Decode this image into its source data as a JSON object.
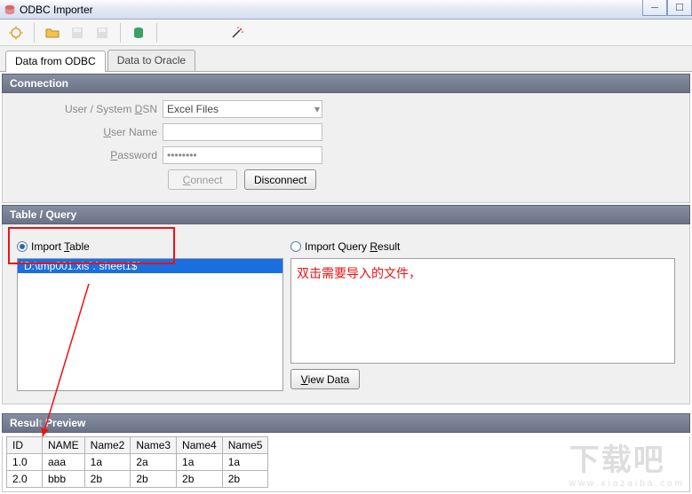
{
  "window": {
    "title": "ODBC Importer"
  },
  "toolbar": {
    "icons": [
      "new",
      "open",
      "save",
      "save-disabled",
      "db",
      "wand"
    ]
  },
  "tabs": {
    "items": [
      {
        "label": "Data from ODBC",
        "active": true
      },
      {
        "label": "Data to Oracle",
        "active": false
      }
    ]
  },
  "connection": {
    "header": "Connection",
    "dsn_label": "User / System DSN",
    "dsn_value": "Excel Files",
    "user_label": "User Name",
    "user_value": "",
    "password_label": "Password",
    "password_value": "********",
    "connect_label": "Connect",
    "disconnect_label": "Disconnect"
  },
  "table_query": {
    "header": "Table / Query",
    "import_table_label": "Import Table",
    "import_query_label": "Import Query Result",
    "selected_file": "`D:\\tmp001.xls`.`sheet1$`",
    "annotation_text": "双击需要导入的文件，",
    "view_data_label": "View Data"
  },
  "result_preview": {
    "header": "Result Preview",
    "columns": [
      "ID",
      "NAME",
      "Name2",
      "Name3",
      "Name4",
      "Name5"
    ],
    "rows": [
      [
        "1.0",
        "aaa",
        "1a",
        "2a",
        "1a",
        "1a"
      ],
      [
        "2.0",
        "bbb",
        "2b",
        "2b",
        "2b",
        "2b"
      ]
    ]
  },
  "watermark": {
    "big": "下载吧",
    "small": "www.xiazaiba.com"
  }
}
